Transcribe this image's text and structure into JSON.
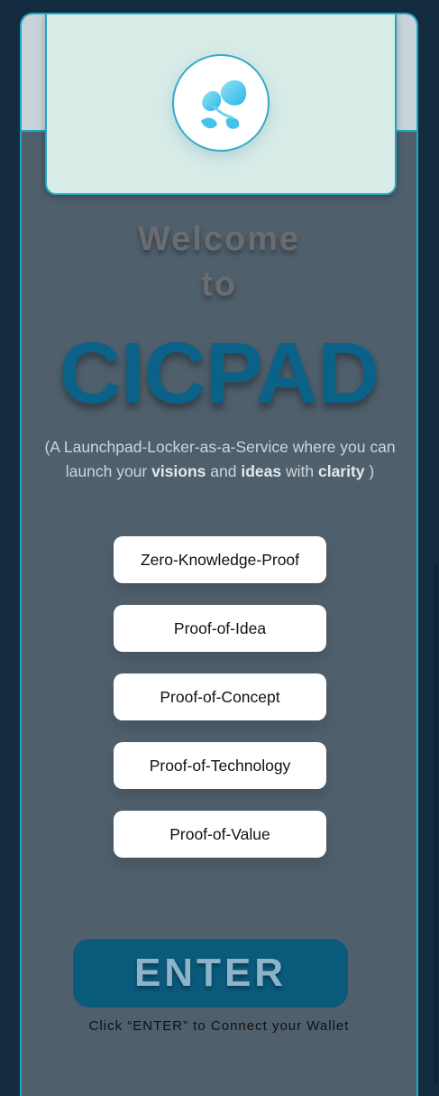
{
  "header": {
    "logo_icon": "cicpad-logo-icon"
  },
  "hero": {
    "welcome_line1": "Welcome",
    "welcome_line2": "to",
    "brand_name": "CICPAD",
    "tagline_open": "(A Launchpad-Locker-as-a-Service where you can launch your ",
    "tagline_visions": "visions",
    "tagline_and": " and ",
    "tagline_ideas": "ideas",
    "tagline_with": " with ",
    "tagline_clarity": "clarity",
    "tagline_close": " )"
  },
  "features": [
    {
      "label": "Zero-Knowledge-Proof"
    },
    {
      "label": "Proof-of-Idea"
    },
    {
      "label": "Proof-of-Concept"
    },
    {
      "label": "Proof-of-Technology"
    },
    {
      "label": "Proof-of-Value"
    }
  ],
  "cta": {
    "enter_label": "ENTER",
    "hint": "Click “ENTER” to Connect your Wallet"
  },
  "colors": {
    "background": "#122b3f",
    "panel": "#4f5f6c",
    "accent_border": "#1fa6c4",
    "brand": "#0a6289",
    "enter_button": "#0a5a7c"
  }
}
